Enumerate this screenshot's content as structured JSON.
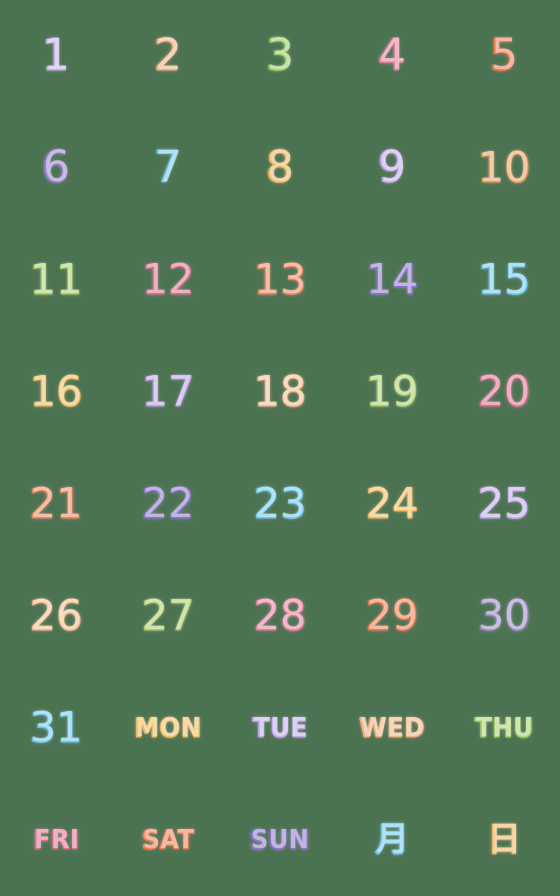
{
  "sheet": {
    "background_color": "#4b7251",
    "columns": 5,
    "rows": 8,
    "title": "Pastel handwritten calendar number sticker sheet"
  },
  "palette": {
    "lavender": "#C9AEE8",
    "peach": "#F2AE7C",
    "green": "#9ACB63",
    "pink": "#E87B98",
    "coral": "#F4774E",
    "purple": "#9B7BD4",
    "sky": "#6CC6EF",
    "amber": "#F0B45F",
    "light_purple": "#C3A6ED",
    "orange": "#EF9C5A",
    "light_green": "#A8CE6A",
    "rose": "#E26A8D",
    "salmon": "#F4815B",
    "violet": "#8E6FD0",
    "gold": "#F2B95E",
    "mauve": "#BE9FE6",
    "apricot": "#F6B98B",
    "blush": "#E87B9B",
    "lilac": "#9B85C4"
  },
  "cells": [
    {
      "label": "1",
      "kind": "number",
      "color": "#C9AEE8",
      "color_name": "lavender",
      "row": 1,
      "col": 1
    },
    {
      "label": "2",
      "kind": "number",
      "color": "#F2AE7C",
      "color_name": "peach",
      "row": 1,
      "col": 2
    },
    {
      "label": "3",
      "kind": "number",
      "color": "#9ACB63",
      "color_name": "green",
      "row": 1,
      "col": 3
    },
    {
      "label": "4",
      "kind": "number",
      "color": "#E87B98",
      "color_name": "pink",
      "row": 1,
      "col": 4
    },
    {
      "label": "5",
      "kind": "number",
      "color": "#F4774E",
      "color_name": "coral",
      "row": 1,
      "col": 5
    },
    {
      "label": "6",
      "kind": "number",
      "color": "#9B7BD4",
      "color_name": "purple",
      "row": 2,
      "col": 1
    },
    {
      "label": "7",
      "kind": "number",
      "color": "#6CC6EF",
      "color_name": "sky",
      "row": 2,
      "col": 2
    },
    {
      "label": "8",
      "kind": "number",
      "color": "#F0B45F",
      "color_name": "amber",
      "row": 2,
      "col": 3
    },
    {
      "label": "9",
      "kind": "number",
      "color": "#C3A6ED",
      "color_name": "light_purple",
      "row": 2,
      "col": 4
    },
    {
      "label": "10",
      "kind": "number",
      "color": "#EF9C5A",
      "color_name": "orange",
      "row": 2,
      "col": 5
    },
    {
      "label": "11",
      "kind": "number",
      "color": "#A8CE6A",
      "color_name": "light_green",
      "row": 3,
      "col": 1
    },
    {
      "label": "12",
      "kind": "number",
      "color": "#E26A8D",
      "color_name": "rose",
      "row": 3,
      "col": 2
    },
    {
      "label": "13",
      "kind": "number",
      "color": "#F4815B",
      "color_name": "salmon",
      "row": 3,
      "col": 3
    },
    {
      "label": "14",
      "kind": "number",
      "color": "#8E6FD0",
      "color_name": "violet",
      "row": 3,
      "col": 4
    },
    {
      "label": "15",
      "kind": "number",
      "color": "#6CC6EF",
      "color_name": "sky",
      "row": 3,
      "col": 5
    },
    {
      "label": "16",
      "kind": "number",
      "color": "#F2B95E",
      "color_name": "gold",
      "row": 4,
      "col": 1
    },
    {
      "label": "17",
      "kind": "number",
      "color": "#BE9FE6",
      "color_name": "mauve",
      "row": 4,
      "col": 2
    },
    {
      "label": "18",
      "kind": "number",
      "color": "#F6B98B",
      "color_name": "apricot",
      "row": 4,
      "col": 3
    },
    {
      "label": "19",
      "kind": "number",
      "color": "#A8CE6A",
      "color_name": "light_green",
      "row": 4,
      "col": 4
    },
    {
      "label": "20",
      "kind": "number",
      "color": "#E26A8D",
      "color_name": "rose",
      "row": 4,
      "col": 5
    },
    {
      "label": "21",
      "kind": "number",
      "color": "#F4815B",
      "color_name": "salmon",
      "row": 5,
      "col": 1
    },
    {
      "label": "22",
      "kind": "number",
      "color": "#8E6FD0",
      "color_name": "violet",
      "row": 5,
      "col": 2
    },
    {
      "label": "23",
      "kind": "number",
      "color": "#6CC6EF",
      "color_name": "sky",
      "row": 5,
      "col": 3
    },
    {
      "label": "24",
      "kind": "number",
      "color": "#F2B95E",
      "color_name": "gold",
      "row": 5,
      "col": 4
    },
    {
      "label": "25",
      "kind": "number",
      "color": "#C3A6ED",
      "color_name": "light_purple",
      "row": 5,
      "col": 5
    },
    {
      "label": "26",
      "kind": "number",
      "color": "#F6B98B",
      "color_name": "apricot",
      "row": 6,
      "col": 1
    },
    {
      "label": "27",
      "kind": "number",
      "color": "#A8CE6A",
      "color_name": "light_green",
      "row": 6,
      "col": 2
    },
    {
      "label": "28",
      "kind": "number",
      "color": "#E87B9B",
      "color_name": "blush",
      "row": 6,
      "col": 3
    },
    {
      "label": "29",
      "kind": "number",
      "color": "#F4774E",
      "color_name": "coral",
      "row": 6,
      "col": 4
    },
    {
      "label": "30",
      "kind": "number",
      "color": "#9B85C4",
      "color_name": "lilac",
      "row": 6,
      "col": 5
    },
    {
      "label": "31",
      "kind": "number",
      "color": "#6CC6EF",
      "color_name": "sky",
      "row": 7,
      "col": 1
    },
    {
      "label": "MON",
      "kind": "weekday",
      "color": "#F2B95E",
      "color_name": "gold",
      "row": 7,
      "col": 2
    },
    {
      "label": "TUE",
      "kind": "weekday",
      "color": "#C3A6ED",
      "color_name": "light_purple",
      "row": 7,
      "col": 3
    },
    {
      "label": "WED",
      "kind": "weekday",
      "color": "#F2AE7C",
      "color_name": "peach",
      "row": 7,
      "col": 4
    },
    {
      "label": "THU",
      "kind": "weekday",
      "color": "#A8CE6A",
      "color_name": "light_green",
      "row": 7,
      "col": 5
    },
    {
      "label": "FRI",
      "kind": "weekday",
      "color": "#E26A8D",
      "color_name": "rose",
      "row": 8,
      "col": 1
    },
    {
      "label": "SAT",
      "kind": "weekday",
      "color": "#F4774E",
      "color_name": "coral",
      "row": 8,
      "col": 2
    },
    {
      "label": "SUN",
      "kind": "weekday",
      "color": "#8E6FD0",
      "color_name": "violet",
      "row": 8,
      "col": 3
    },
    {
      "label": "月",
      "kind": "cjk",
      "color": "#6CC6EF",
      "color_name": "sky",
      "row": 8,
      "col": 4
    },
    {
      "label": "日",
      "kind": "cjk",
      "color": "#F0B45F",
      "color_name": "amber",
      "row": 8,
      "col": 5
    }
  ]
}
